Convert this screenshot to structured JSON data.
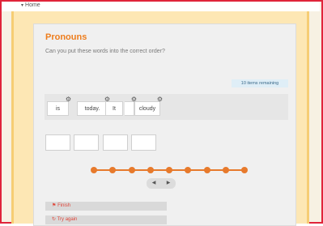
{
  "top": {
    "home_label": "Home",
    "home_icon": "triangle-down-icon"
  },
  "activity": {
    "title": "Pronouns",
    "instruction": "Can you put these words into the correct order?",
    "remaining_label": "10 items remaining"
  },
  "words": [
    {
      "label": "is"
    },
    {
      "label": "today."
    },
    {
      "label": "It"
    },
    {
      "label": "cloudy"
    }
  ],
  "answer_slots": 4,
  "progress": {
    "total_steps": 9,
    "accent": "#e77a2c"
  },
  "navigation": {
    "prev_icon": "chevron-left-icon",
    "next_icon": "chevron-right-icon"
  },
  "side_buttons": [
    {
      "label": "Finish",
      "icon": "flag-icon"
    },
    {
      "label": "Try again",
      "icon": "refresh-icon"
    }
  ],
  "colors": {
    "title": "#ee7d1d",
    "frame_border": "#e0243a",
    "band": "#fde7b4"
  }
}
